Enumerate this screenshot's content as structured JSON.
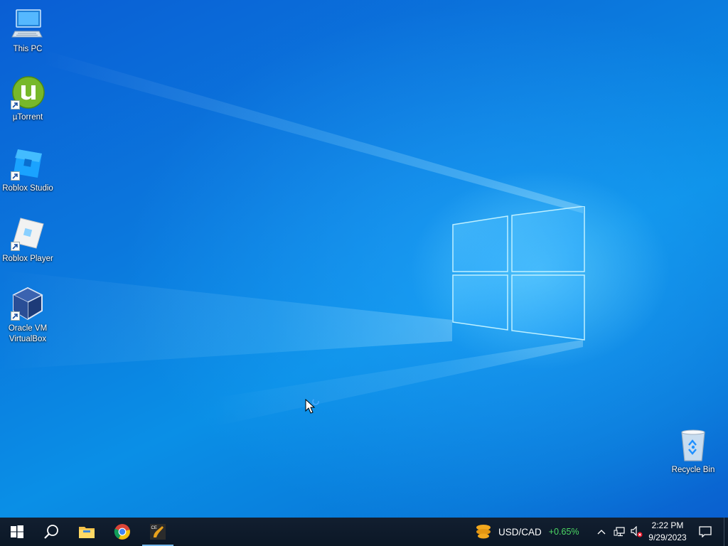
{
  "desktop": {
    "icons": [
      {
        "label": "This PC",
        "icon": "this-pc-icon"
      },
      {
        "label": "µTorrent",
        "icon": "utorrent-icon"
      },
      {
        "label": "Roblox Studio",
        "icon": "roblox-studio-icon"
      },
      {
        "label": "Roblox Player",
        "icon": "roblox-player-icon"
      },
      {
        "label": "Oracle VM\nVirtualBox",
        "icon": "virtualbox-icon"
      },
      {
        "label": "Recycle Bin",
        "icon": "recycle-bin-icon"
      }
    ]
  },
  "taskbar": {
    "start": {
      "icon": "windows-start-icon"
    },
    "search": {
      "icon": "search-icon"
    },
    "apps": [
      {
        "name": "File Explorer",
        "icon": "file-explorer-icon"
      },
      {
        "name": "Google Chrome",
        "icon": "chrome-icon"
      },
      {
        "name": "Cheat Engine",
        "icon": "cheat-engine-icon",
        "active": true
      }
    ],
    "widget": {
      "pair": "USD/CAD",
      "change": "+0.65%",
      "change_color": "#4cd964"
    },
    "tray": {
      "icons": [
        "chevron-up-icon",
        "network-icon",
        "volume-muted-icon"
      ]
    },
    "clock": {
      "time": "2:22 PM",
      "date": "9/29/2023"
    },
    "notifications": {
      "icon": "action-center-icon"
    }
  },
  "colors": {
    "accent": "#76b9ed",
    "taskbar": "#0d1a2a",
    "wallpaper": "#0a7fe0"
  }
}
